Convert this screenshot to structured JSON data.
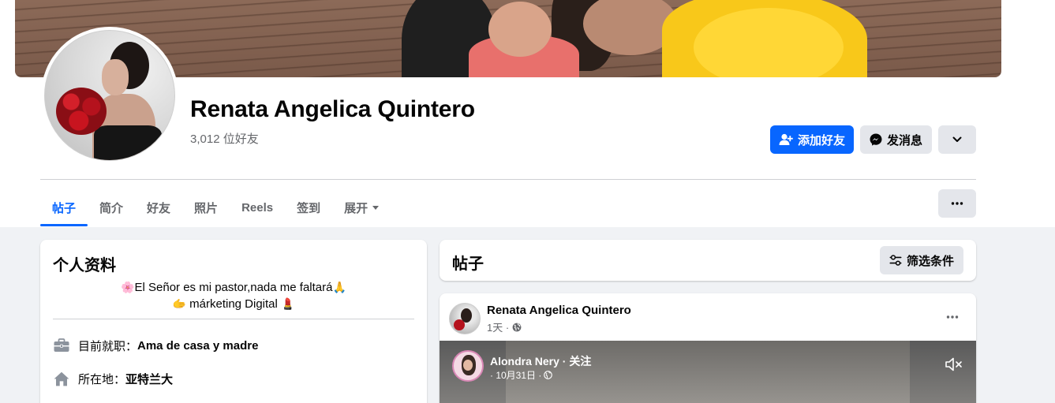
{
  "profile": {
    "name": "Renata Angelica Quintero",
    "friends_count": "3,012 位好友"
  },
  "actions": {
    "add_friend": "添加好友",
    "message": "发消息"
  },
  "tabs": [
    {
      "label": "帖子",
      "active": true
    },
    {
      "label": "简介",
      "active": false
    },
    {
      "label": "好友",
      "active": false
    },
    {
      "label": "照片",
      "active": false
    },
    {
      "label": "Reels",
      "active": false
    },
    {
      "label": "签到",
      "active": false
    },
    {
      "label": "展开",
      "active": false
    }
  ],
  "intro": {
    "title": "个人资料",
    "bio_line1": "El Señor es mi pastor,nada me faltará",
    "bio_line2": "márketing Digital",
    "bio_emojis": [
      "🌸",
      "🙏",
      "🫱",
      "💄"
    ],
    "work_label": "目前就职：",
    "work_value": "Ama de casa y madre",
    "location_label": "所在地：",
    "location_value": "亚特兰大"
  },
  "posts": {
    "title": "帖子",
    "filter_label": "筛选条件",
    "post": {
      "author": "Renata Angelica Quintero",
      "time": "1天 ·",
      "shared_author": "Alondra Nery · 关注",
      "shared_time": "· 10月31日 ·"
    }
  },
  "colors": {
    "accent": "#0866ff",
    "secondary_button": "#e4e6eb",
    "page_background": "#f0f2f5",
    "muted_text": "#65676b"
  },
  "icons": [
    "add-friend-icon",
    "messenger-icon",
    "chevron-down-icon",
    "more-dots-icon",
    "filter-icon",
    "briefcase-icon",
    "home-icon",
    "globe-icon",
    "mute-icon"
  ]
}
